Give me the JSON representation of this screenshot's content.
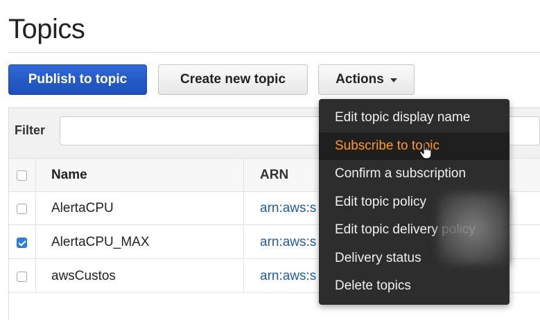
{
  "page": {
    "title": "Topics"
  },
  "toolbar": {
    "publish_label": "Publish to topic",
    "create_label": "Create new topic",
    "actions_label": "Actions"
  },
  "filter": {
    "label": "Filter",
    "value": "",
    "placeholder": ""
  },
  "table": {
    "headers": {
      "name": "Name",
      "arn": "ARN"
    },
    "rows": [
      {
        "name": "AlertaCPU",
        "arn": "arn:aws:s",
        "checked": false
      },
      {
        "name": "AlertaCPU_MAX",
        "arn": "arn:aws:s",
        "checked": true
      },
      {
        "name": "awsCustos",
        "arn": "arn:aws:s",
        "checked": false
      }
    ]
  },
  "actions_menu": {
    "items": [
      {
        "label": "Edit topic display name"
      },
      {
        "label": "Subscribe to topic",
        "active": true
      },
      {
        "label": "Confirm a subscription"
      },
      {
        "label": "Edit topic policy"
      },
      {
        "label": "Edit topic delivery policy"
      },
      {
        "label": "Delivery status"
      },
      {
        "label": "Delete topics"
      }
    ]
  },
  "colors": {
    "primary_button": "#1c4fb9",
    "link": "#1f5bb3",
    "menu_bg": "#2d2d2d",
    "menu_active_text": "#ff9a1f",
    "checkbox_checked": "#2f7de1"
  },
  "icons": {
    "cursor": "hand-pointer-icon",
    "dropdown": "caret-down-icon"
  }
}
